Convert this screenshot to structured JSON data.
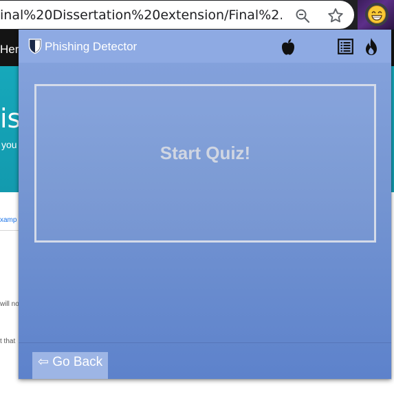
{
  "browser": {
    "url": "inal%20Dissertation%20extension/Final%2...",
    "zoom_icon": "zoom-out-magnifier-icon",
    "bookmark_icon": "star-icon",
    "extension_icon": "grinning-emoji-icon"
  },
  "background_page": {
    "header_text": "Hero",
    "hero_heading": "is",
    "hero_subtext": "you",
    "link_text": "xamp",
    "body_text_1": "will no",
    "body_text_2": "t that",
    "hero_color": "#16a8bb"
  },
  "popup": {
    "title": "Phishing Detector",
    "logo_icon": "shield-icon",
    "header_icons": [
      "apple-icon",
      "list-icon",
      "fire-icon"
    ],
    "quiz_button_label": "Start Quiz!",
    "back_button_label": "⇦ Go Back",
    "colors": {
      "background_top": "#87a4de",
      "background_bottom": "#5d82cb",
      "header": "#8eaae3",
      "back_button": "#9db5e5"
    }
  }
}
